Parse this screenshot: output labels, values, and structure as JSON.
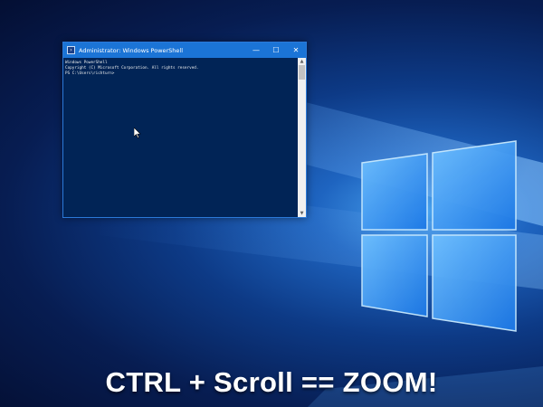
{
  "window": {
    "title": "Administrator: Windows PowerShell",
    "controls": {
      "minimize": "—",
      "maximize": "☐",
      "close": "✕"
    }
  },
  "console": {
    "lines": [
      "Windows PowerShell",
      "Copyright (C) Microsoft Corporation. All rights reserved.",
      "",
      "PS C:\\Users\\richturn>"
    ]
  },
  "scrollbar": {
    "up": "▲",
    "down": "▼"
  },
  "caption": "CTRL + Scroll == ZOOM!",
  "colors": {
    "console_bg": "#012456",
    "titlebar": "#1b74d6",
    "console_text": "#eeeeee",
    "caption": "#ffffff"
  },
  "icons": {
    "title": "powershell-icon",
    "cursor": "mouse-pointer-icon",
    "wallpaper": "windows-logo-icon"
  }
}
